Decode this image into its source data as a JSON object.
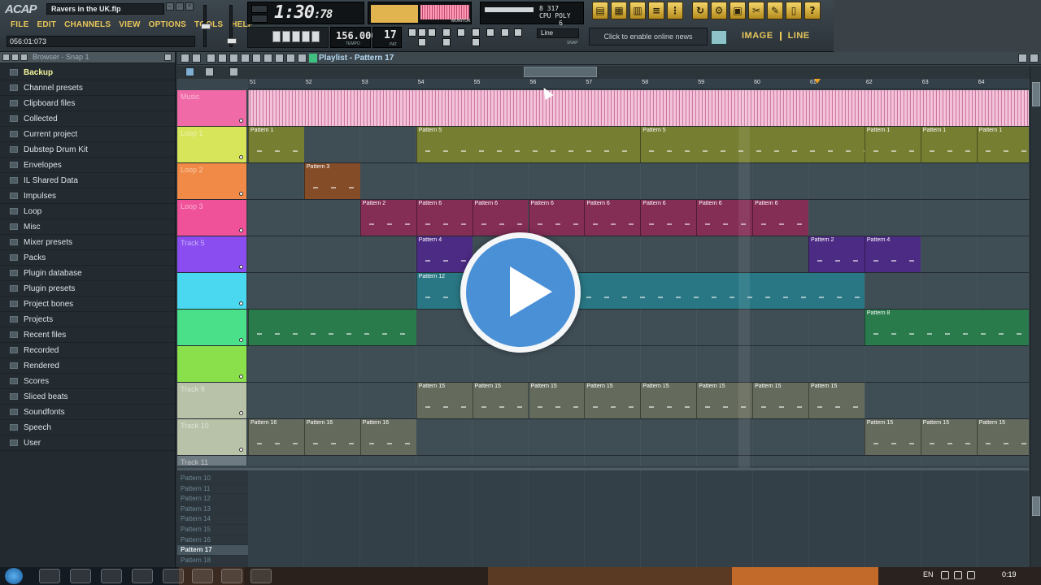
{
  "app": {
    "logo": "ACAP",
    "project_title": "Ravers in the UK.flp",
    "hint_readout": "056:01:073"
  },
  "menu": [
    "FILE",
    "EDIT",
    "CHANNELS",
    "VIEW",
    "OPTIONS",
    "TOOLS",
    "HELP"
  ],
  "transport": {
    "time": "1:30",
    "time_fraction": ":78",
    "tempo": "156.000",
    "tempo_label": "TEMPO",
    "pattern": "17",
    "pattern_label": "PAT",
    "monitor_label": "MONITOR",
    "cpu_text": "8 317\nCPU POLY\n     6"
  },
  "snap": {
    "value": "Line",
    "label": "SNAP"
  },
  "news": {
    "text": "Click to enable online news"
  },
  "image_line": {
    "image": "IMAGE",
    "line": "LINE"
  },
  "browser": {
    "title": "Browser - Snap 1",
    "items": [
      {
        "label": "Backup",
        "style": "green"
      },
      {
        "label": "Channel presets",
        "style": "normal"
      },
      {
        "label": "Clipboard files",
        "style": "normal"
      },
      {
        "label": "Collected",
        "style": "normal"
      },
      {
        "label": "Current project",
        "style": "normal"
      },
      {
        "label": "Dubstep Drum Kit",
        "style": "normal"
      },
      {
        "label": "Envelopes",
        "style": "normal"
      },
      {
        "label": "IL Shared Data",
        "style": "normal"
      },
      {
        "label": "Impulses",
        "style": "normal"
      },
      {
        "label": "Loop",
        "style": "normal"
      },
      {
        "label": "Misc",
        "style": "normal"
      },
      {
        "label": "Mixer presets",
        "style": "normal"
      },
      {
        "label": "Packs",
        "style": "normal"
      },
      {
        "label": "Plugin database",
        "style": "normal"
      },
      {
        "label": "Plugin presets",
        "style": "normal"
      },
      {
        "label": "Project bones",
        "style": "normal"
      },
      {
        "label": "Projects",
        "style": "normal"
      },
      {
        "label": "Recent files",
        "style": "normal"
      },
      {
        "label": "Recorded",
        "style": "normal"
      },
      {
        "label": "Rendered",
        "style": "normal"
      },
      {
        "label": "Scores",
        "style": "normal"
      },
      {
        "label": "Sliced beats",
        "style": "normal"
      },
      {
        "label": "Soundfonts",
        "style": "normal"
      },
      {
        "label": "Speech",
        "style": "normal"
      },
      {
        "label": "User",
        "style": "normal"
      }
    ]
  },
  "playlist": {
    "title": "Playlist - Pattern 17",
    "bars": [
      "51",
      "52",
      "53",
      "54",
      "55",
      "56",
      "57",
      "58",
      "59",
      "60",
      "61",
      "62",
      "63",
      "64"
    ],
    "tracks": [
      {
        "name": "Music",
        "color": "#f06aa8",
        "clips": []
      },
      {
        "name": "Loop 1",
        "color": "#d6e55a",
        "clips": [
          {
            "label": "Pattern 1",
            "start": 0,
            "len": 1
          },
          {
            "label": "Pattern 5",
            "start": 3,
            "len": 4
          },
          {
            "label": "Pattern 5",
            "start": 7,
            "len": 4
          },
          {
            "label": "Pattern 1",
            "start": 11,
            "len": 1
          },
          {
            "label": "Pattern 1",
            "start": 12,
            "len": 1
          },
          {
            "label": "Pattern 1",
            "start": 13,
            "len": 1
          }
        ]
      },
      {
        "name": "Loop 2",
        "color": "#f08a46",
        "clips": [
          {
            "label": "Pattern 3",
            "start": 1,
            "len": 1
          }
        ]
      },
      {
        "name": "Loop 3",
        "color": "#f0529a",
        "clips": [
          {
            "label": "Pattern 2",
            "start": 2,
            "len": 1
          },
          {
            "label": "Pattern 6",
            "start": 3,
            "len": 1
          },
          {
            "label": "Pattern 6",
            "start": 4,
            "len": 1
          },
          {
            "label": "Pattern 6",
            "start": 5,
            "len": 1
          },
          {
            "label": "Pattern 6",
            "start": 6,
            "len": 1
          },
          {
            "label": "Pattern 6",
            "start": 7,
            "len": 1
          },
          {
            "label": "Pattern 6",
            "start": 8,
            "len": 1
          },
          {
            "label": "Pattern 6",
            "start": 9,
            "len": 1
          }
        ]
      },
      {
        "name": "Track 5",
        "color": "#8a4ef0",
        "clips": [
          {
            "label": "Pattern 4",
            "start": 3,
            "len": 1
          },
          {
            "label": "Pattern 2",
            "start": 10,
            "len": 1
          },
          {
            "label": "Pattern 4",
            "start": 11,
            "len": 1
          }
        ]
      },
      {
        "name": "",
        "color": "#4ad8f0",
        "clips": [
          {
            "label": "Pattern 12",
            "start": 3,
            "len": 8
          }
        ]
      },
      {
        "name": "",
        "color": "#4ae08a",
        "clips": [
          {
            "label": "",
            "start": 0,
            "len": 3
          },
          {
            "label": "Pattern 8",
            "start": 11,
            "len": 3
          }
        ]
      },
      {
        "name": "",
        "color": "#8ae04a",
        "clips": []
      },
      {
        "name": "Track 9",
        "color": "#b8c2a8",
        "clips": [
          {
            "label": "Pattern 15",
            "start": 3,
            "len": 1
          },
          {
            "label": "Pattern 15",
            "start": 4,
            "len": 1
          },
          {
            "label": "Pattern 15",
            "start": 5,
            "len": 1
          },
          {
            "label": "Pattern 15",
            "start": 6,
            "len": 1
          },
          {
            "label": "Pattern 15",
            "start": 7,
            "len": 1
          },
          {
            "label": "Pattern 15",
            "start": 8,
            "len": 1
          },
          {
            "label": "Pattern 15",
            "start": 9,
            "len": 1
          },
          {
            "label": "Pattern 15",
            "start": 10,
            "len": 1
          }
        ]
      },
      {
        "name": "Track 10",
        "color": "#b8c2a8",
        "clips": [
          {
            "label": "Pattern 16",
            "start": 0,
            "len": 1
          },
          {
            "label": "Pattern 16",
            "start": 1,
            "len": 1
          },
          {
            "label": "Pattern 16",
            "start": 2,
            "len": 1
          },
          {
            "label": "Pattern 15",
            "start": 11,
            "len": 1
          },
          {
            "label": "Pattern 15",
            "start": 12,
            "len": 1
          },
          {
            "label": "Pattern 15",
            "start": 13,
            "len": 1
          }
        ]
      },
      {
        "name": "Track 11",
        "color": "#6f7b82",
        "clips": []
      }
    ],
    "patterns": [
      "Pattern 10",
      "Pattern 11",
      "Pattern 12",
      "Pattern 13",
      "Pattern 14",
      "Pattern 15",
      "Pattern 16",
      "Pattern 17",
      "Pattern 18"
    ],
    "selected_pattern": "Pattern 17"
  },
  "taskbar": {
    "lang": "EN",
    "clock": "0:19"
  }
}
